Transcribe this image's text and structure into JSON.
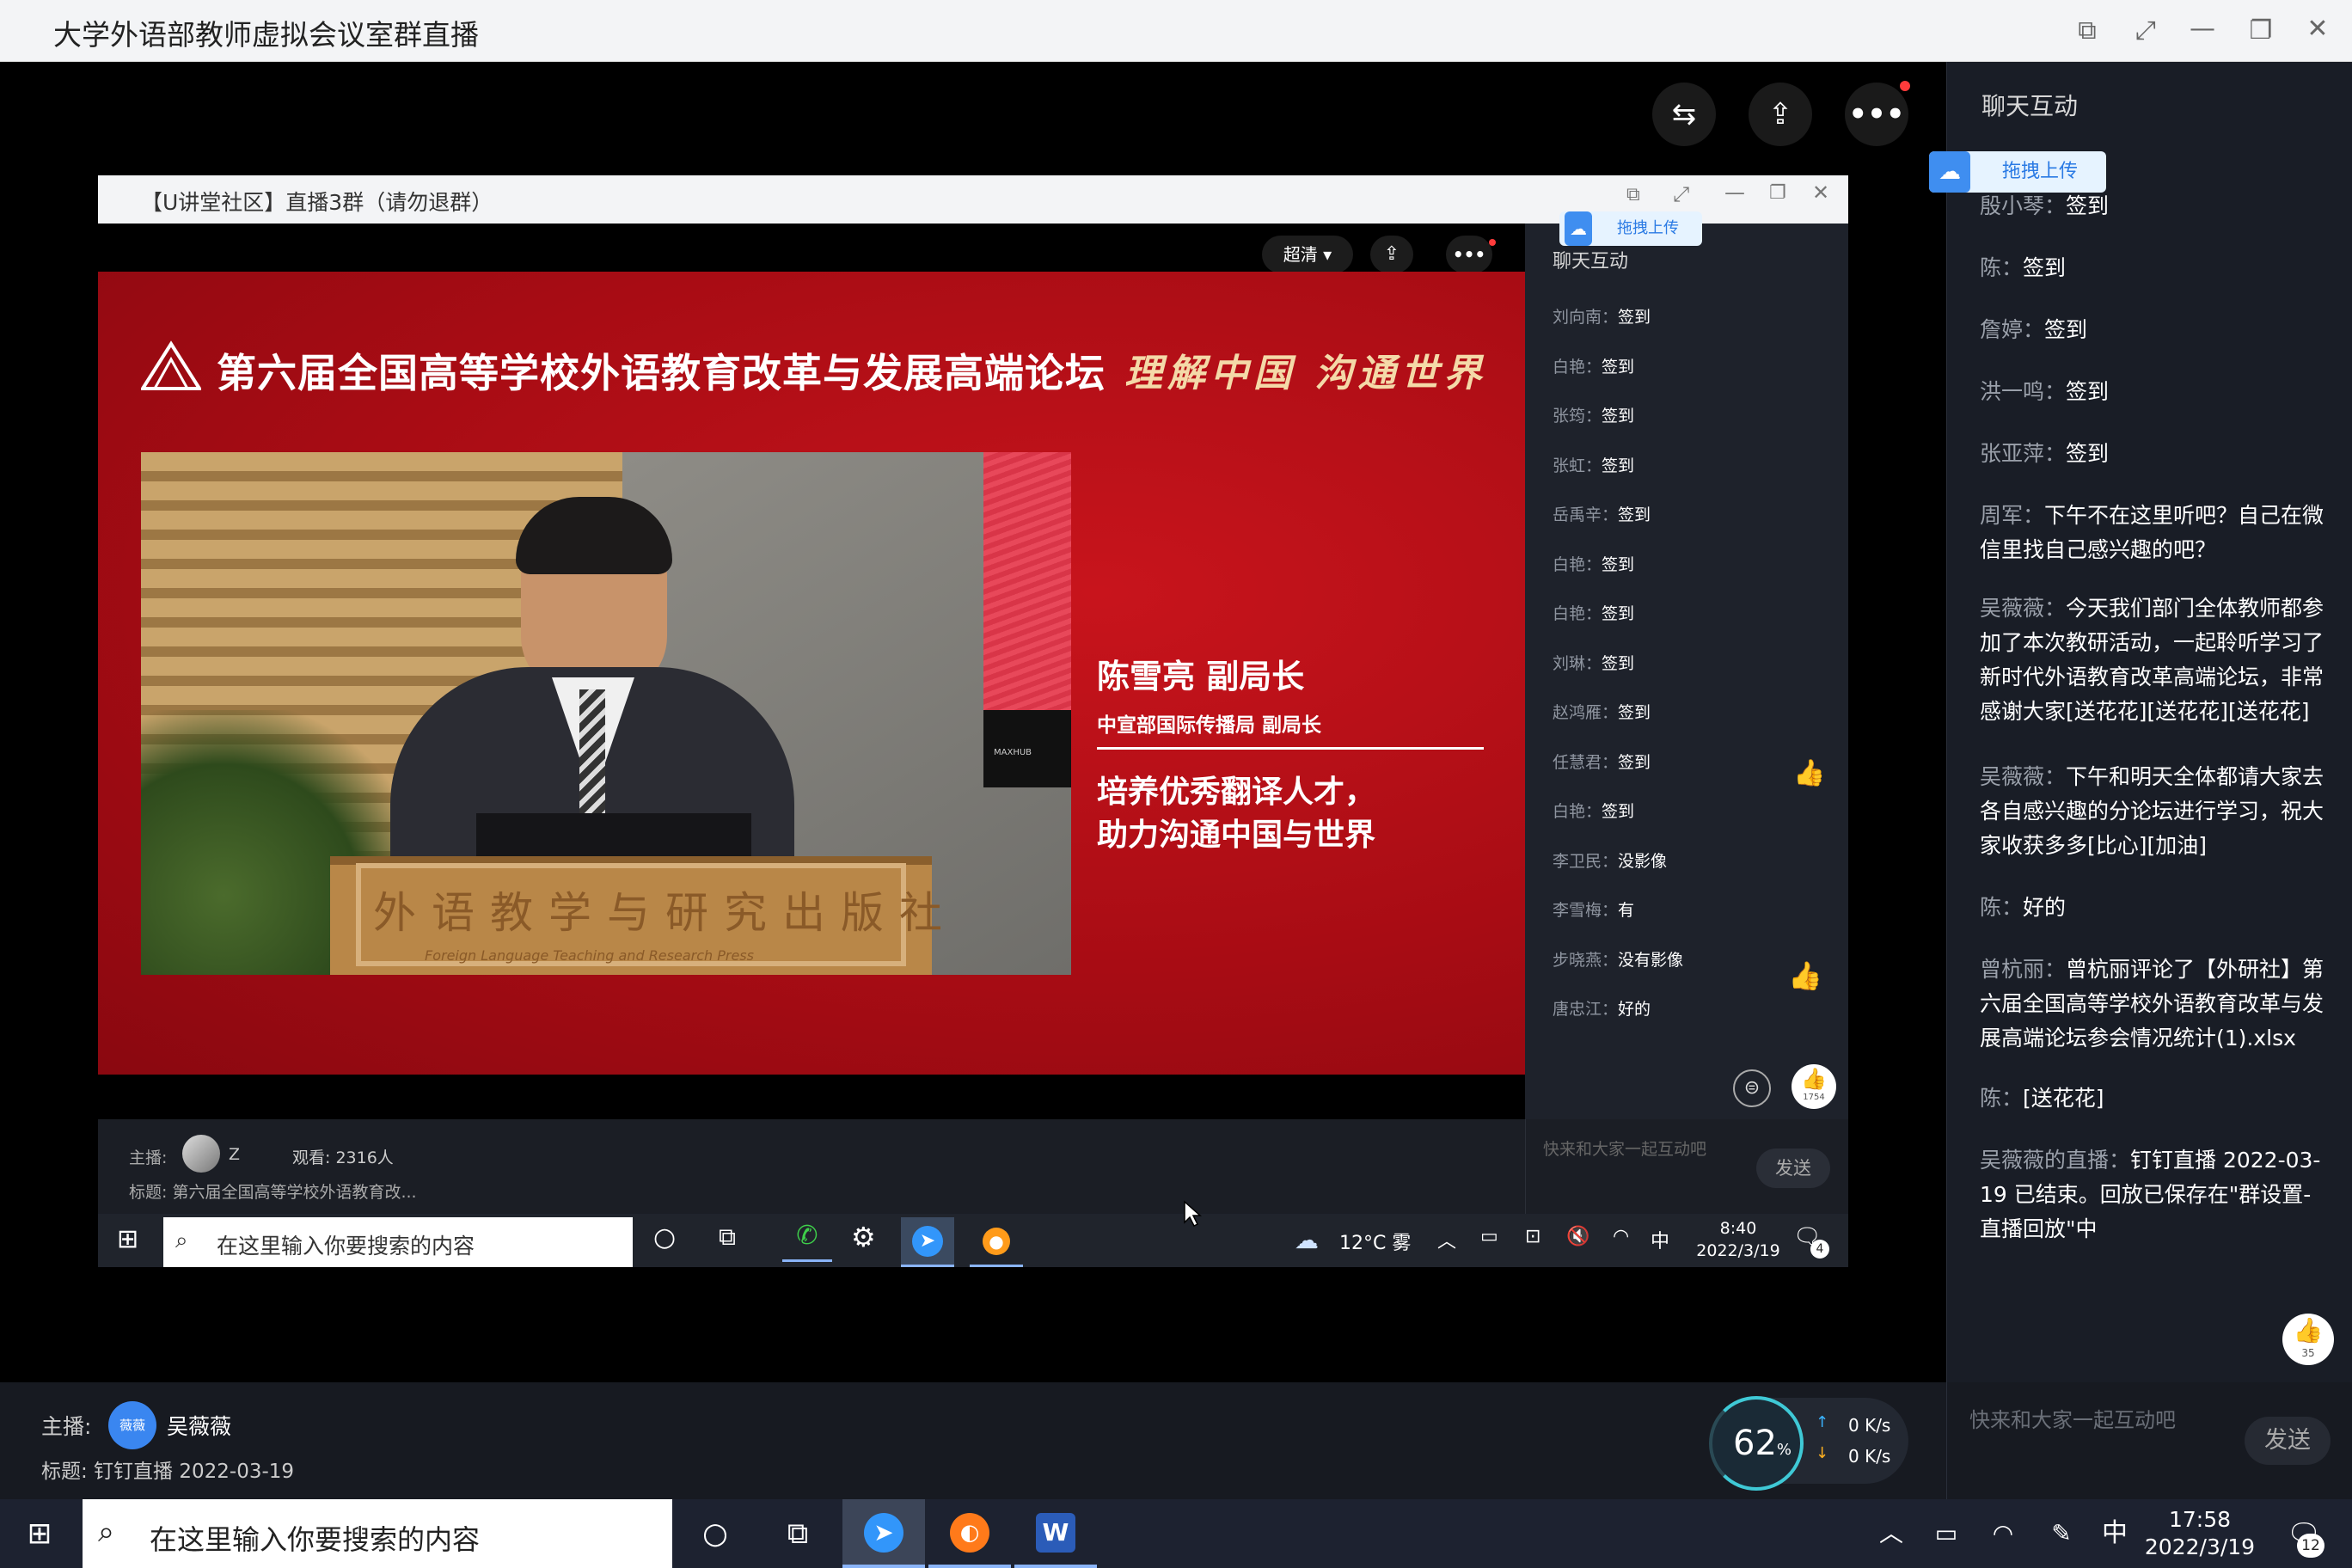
{
  "window": {
    "title": "大学外语部教师虚拟会议室群直播"
  },
  "outer_chat": {
    "title": "聊天互动",
    "upload_badge": "拖拽上传",
    "partial_top": "…",
    "messages": [
      {
        "name": "殷小琴：",
        "text": "签到"
      },
      {
        "name": "陈：",
        "text": "签到"
      },
      {
        "name": "詹婷：",
        "text": "签到"
      },
      {
        "name": "洪一鸣：",
        "text": "签到"
      },
      {
        "name": "张亚萍：",
        "text": "签到"
      },
      {
        "name": "周军：",
        "text": "下午不在这里听吧？自己在微信里找自己感兴趣的吧？"
      },
      {
        "name": "吴薇薇：",
        "text": "今天我们部门全体教师都参加了本次教研活动，一起聆听学习了新时代外语教育改革高端论坛，非常感谢大家[送花花][送花花][送花花]"
      },
      {
        "name": "吴薇薇：",
        "text": "下午和明天全体都请大家去各自感兴趣的分论坛进行学习，祝大家收获多多[比心][加油]"
      },
      {
        "name": "陈：",
        "text": "好的"
      },
      {
        "name": "曾杭丽：",
        "text": "曾杭丽评论了【外研社】第六届全国高等学校外语教育改革与发展高端论坛参会情况统计(1).xlsx"
      },
      {
        "name": "陈：",
        "text": "[送花花]"
      },
      {
        "name": "吴薇薇的直播：",
        "text": "钉钉直播 2022-03-19 已结束。回放已保存在\"群设置-直播回放\"中"
      }
    ],
    "like_count": "35",
    "input_placeholder": "快来和大家一起互动吧",
    "send_label": "发送"
  },
  "inner_window": {
    "title": "【U讲堂社区】直播3群（请勿退群）",
    "quality_label": "超清",
    "upload_badge": "拖拽上传"
  },
  "slide": {
    "headline": "第六届全国高等学校外语教育改革与发展高端论坛",
    "slogan": "理解中国 沟通世界",
    "speaker_name": "陈雪亮 副局长",
    "speaker_title": "中宣部国际传播局 副局长",
    "topic_line1": "培养优秀翻译人才，",
    "topic_line2": "助力沟通中国与世界",
    "podium_text": "外语教学与研究出版社",
    "podium_subtext": "Foreign Language Teaching and Research Press",
    "screen_brand": "MAXHUB"
  },
  "inner_chat": {
    "title": "聊天互动",
    "messages": [
      {
        "name": "刘向南：",
        "text": "签到"
      },
      {
        "name": "白艳：",
        "text": "签到"
      },
      {
        "name": "张筠：",
        "text": "签到"
      },
      {
        "name": "张虹：",
        "text": "签到"
      },
      {
        "name": "岳禹辛：",
        "text": "签到"
      },
      {
        "name": "白艳：",
        "text": "签到"
      },
      {
        "name": "白艳：",
        "text": "签到"
      },
      {
        "name": "刘琳：",
        "text": "签到"
      },
      {
        "name": "赵鸿雁：",
        "text": "签到"
      },
      {
        "name": "任慧君：",
        "text": "签到"
      },
      {
        "name": "白艳：",
        "text": "签到"
      },
      {
        "name": "李卫民：",
        "text": "没影像"
      },
      {
        "name": "李雪梅：",
        "text": "有"
      },
      {
        "name": "步晓燕：",
        "text": "没有影像"
      },
      {
        "name": "唐忠江：",
        "text": "好的"
      }
    ],
    "like_count": "1754",
    "input_placeholder": "快来和大家一起互动吧",
    "send_label": "发送"
  },
  "inner_info": {
    "host_label": "主播:",
    "host_name": "Z",
    "viewers": "观看: 2316人",
    "topic": "标题: 第六届全国高等学校外语教育改..."
  },
  "inner_taskbar": {
    "search_placeholder": "在这里输入你要搜索的内容",
    "weather": "12°C 雾",
    "ime": "中",
    "time": "8:40",
    "date": "2022/3/19",
    "notifications": "4"
  },
  "outer_info": {
    "host_label": "主播:",
    "host_avatar_text": "薇薇",
    "host_name": "吴薇薇",
    "topic": "标题: 钉钉直播 2022-03-19",
    "cpu": "62",
    "cpu_unit": "%",
    "up_speed": "0 K/s",
    "down_speed": "0 K/s"
  },
  "taskbar": {
    "search_placeholder": "在这里输入你要搜索的内容",
    "ime": "中",
    "time": "17:58",
    "date": "2022/3/19",
    "notifications": "12"
  }
}
